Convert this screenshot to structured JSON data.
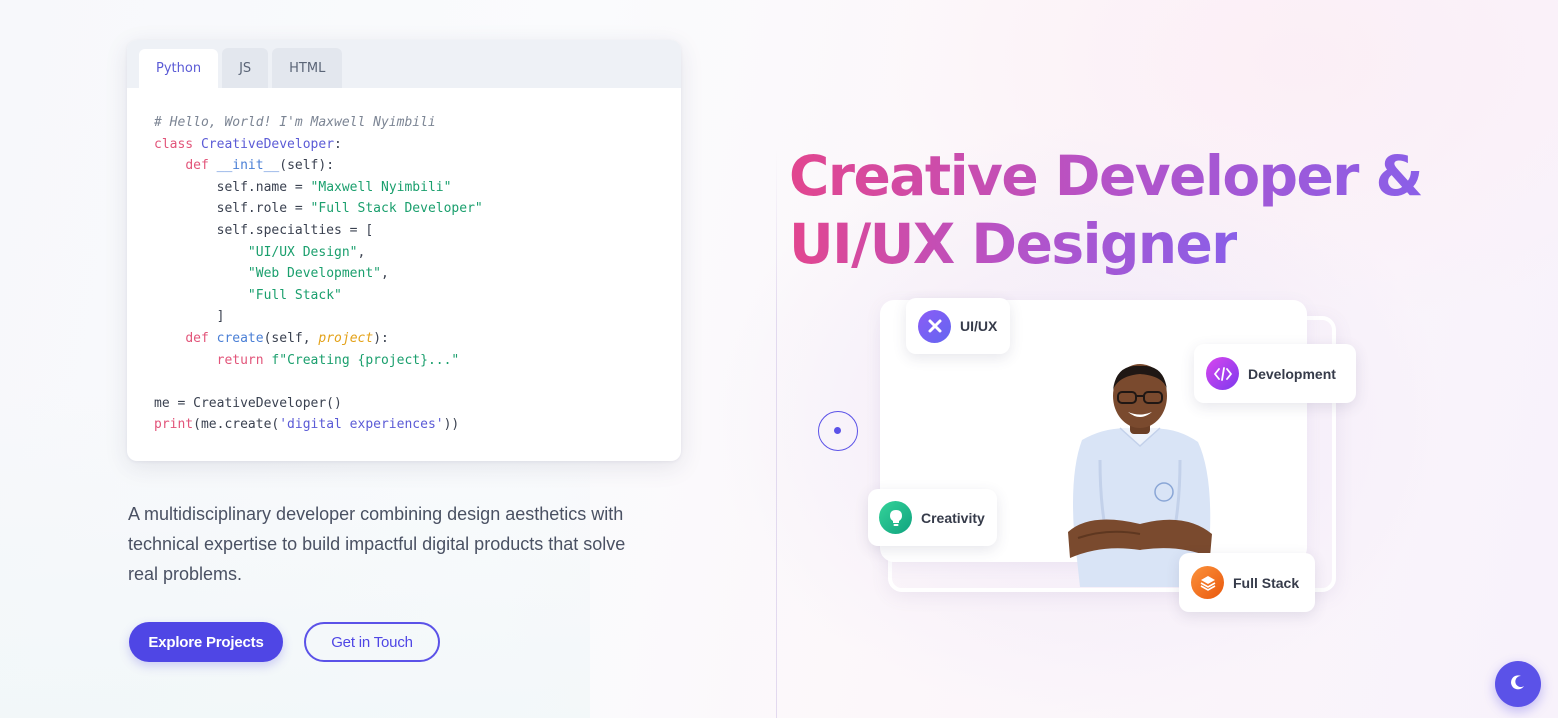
{
  "code_card": {
    "tabs": [
      {
        "label": "Python",
        "active": true
      },
      {
        "label": "JS",
        "active": false
      },
      {
        "label": "HTML",
        "active": false
      }
    ]
  },
  "intro": {
    "text": "A multidisciplinary developer combining design aesthetics with technical expertise to build impactful digital products that solve real problems."
  },
  "buttons": {
    "explore": "Explore Projects",
    "contact": "Get in Touch"
  },
  "hero": {
    "headline_line1": "Creative Developer &",
    "headline_line2": "UI/UX Designer"
  },
  "skills": {
    "uiux": "UI/UX",
    "development": "Development",
    "creativity": "Creativity",
    "fullstack": "Full Stack"
  },
  "icons": {
    "uiux": "figma-x-icon",
    "development": "code-icon",
    "creativity": "lightbulb-icon",
    "fullstack": "layers-icon",
    "theme": "moon-icon"
  },
  "colors": {
    "accent": "#4f46e5",
    "headline_gradient_start": "#e2468f",
    "headline_gradient_end": "#8a5fe8"
  }
}
